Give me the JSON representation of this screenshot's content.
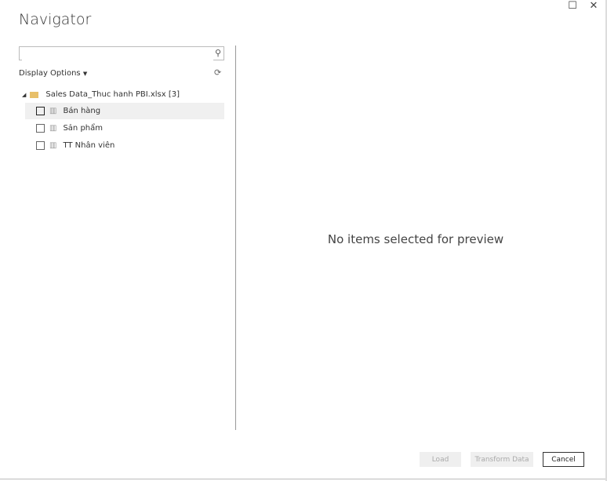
{
  "dialog": {
    "title": "Navigator"
  },
  "search": {
    "value": "",
    "placeholder": ""
  },
  "display_options": "Display Options",
  "tree": {
    "root": {
      "label": "Sales Data_Thuc hanh PBI.xlsx [3]"
    },
    "items": [
      {
        "label": "Bán hàng",
        "checked": false
      },
      {
        "label": "Sản phẩm",
        "checked": false
      },
      {
        "label": "TT Nhân viên",
        "checked": false
      }
    ]
  },
  "preview": {
    "empty_message": "No items selected for preview"
  },
  "buttons": {
    "load": "Load",
    "transform": "Transform Data",
    "cancel": "Cancel"
  }
}
